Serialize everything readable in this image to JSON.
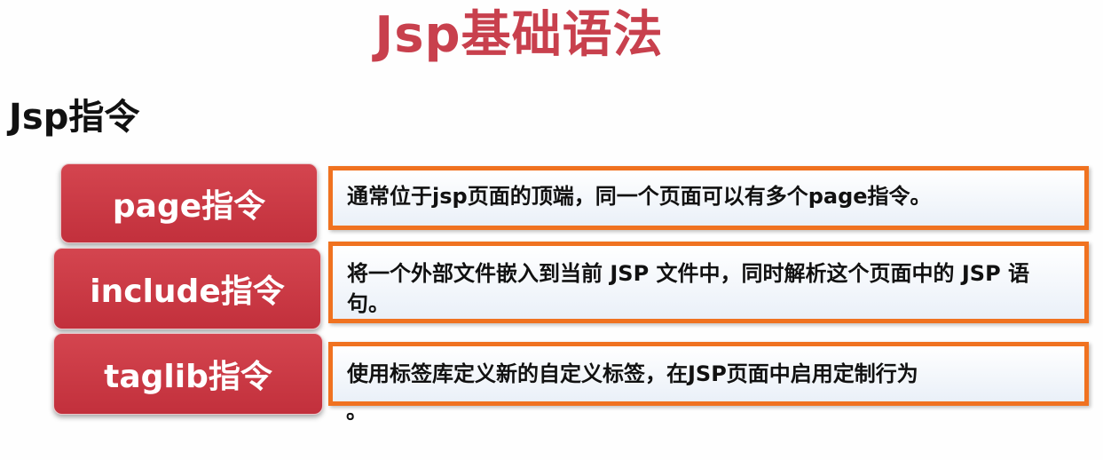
{
  "title": "Jsp基础语法",
  "section_heading": "Jsp指令",
  "directives": [
    {
      "label": "page指令",
      "description": "通常位于jsp页面的顶端，同一个页面可以有多个page指令。"
    },
    {
      "label": "include指令",
      "description": "将一个外部文件嵌入到当前 JSP 文件中，同时解析这个页面中的 JSP 语句。"
    },
    {
      "label": "taglib指令",
      "description": "使用标签库定义新的自定义标签，在JSP页面中启用定制行为",
      "description_overflow": "。"
    }
  ],
  "colors": {
    "title": "#c8404d",
    "label_bg": "#c93440",
    "box_border": "#f07220",
    "box_bg": "#eef3fa"
  }
}
